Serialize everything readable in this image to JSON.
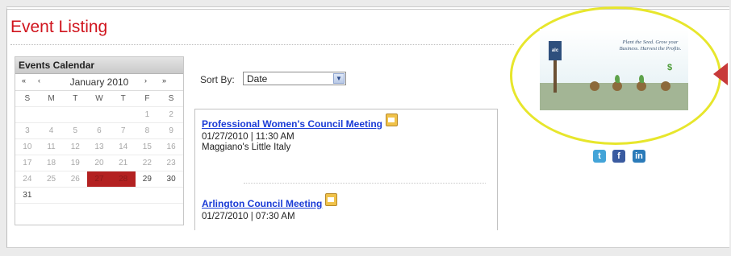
{
  "page": {
    "title": "Event Listing"
  },
  "calendar": {
    "header": "Events Calendar",
    "nav": {
      "first": "«",
      "prev": "‹",
      "month": "January 2010",
      "next": "›",
      "last": "»"
    },
    "weekdays": [
      "S",
      "M",
      "T",
      "W",
      "T",
      "F",
      "S"
    ],
    "weeks": [
      [
        "",
        "",
        "",
        "",
        "",
        "1",
        "2"
      ],
      [
        "3",
        "4",
        "5",
        "6",
        "7",
        "8",
        "9"
      ],
      [
        "10",
        "11",
        "12",
        "13",
        "14",
        "15",
        "16"
      ],
      [
        "17",
        "18",
        "19",
        "20",
        "21",
        "22",
        "23"
      ],
      [
        "24",
        "25",
        "26",
        "27",
        "28",
        "29",
        "30"
      ],
      [
        "31",
        "",
        "",
        "",
        "",
        "",
        ""
      ]
    ],
    "event_days": [
      "27",
      "28"
    ],
    "event_color": "#b32121"
  },
  "sort": {
    "label": "Sort By:",
    "value": "Date"
  },
  "events": [
    {
      "title": "Professional Women's Council Meeting",
      "datetime": "01/27/2010 | 11:30 AM",
      "location": "Maggiano's Little Italy"
    },
    {
      "title": "Arlington Council Meeting",
      "datetime": "01/27/2010 | 07:30 AM",
      "location": ""
    }
  ],
  "promo": {
    "logo": "alc",
    "tagline": "Plant the Seed. Grow your Business. Harvest the Profits.",
    "dollar": "$"
  },
  "social": {
    "twitter": "t",
    "facebook": "f",
    "linkedin": "in"
  },
  "colors": {
    "title": "#d0141d",
    "link": "#1a3bd6",
    "highlight_ring": "#e7e62c"
  }
}
